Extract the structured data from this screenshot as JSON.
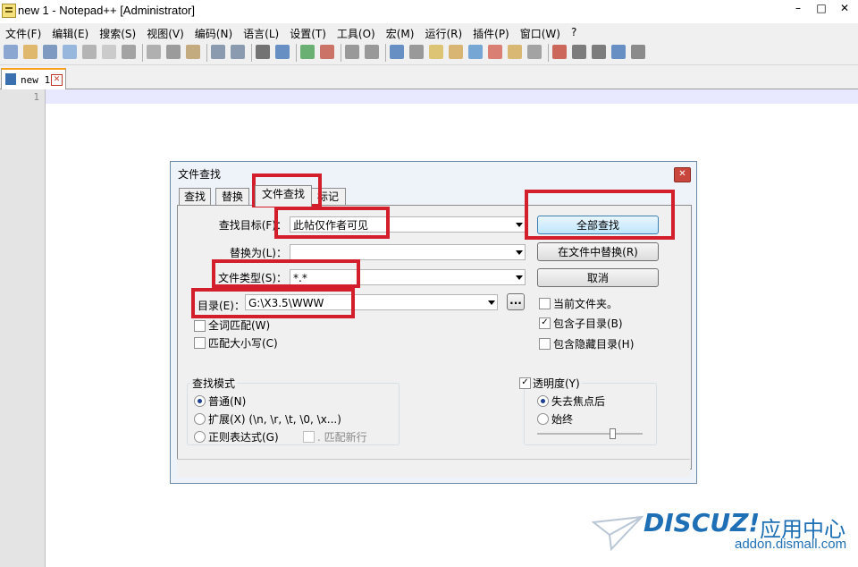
{
  "window": {
    "title": "new 1 - Notepad++ [Administrator]",
    "min": "–",
    "max": "□",
    "close": "✕"
  },
  "menu": [
    "文件(F)",
    "编辑(E)",
    "搜索(S)",
    "视图(V)",
    "编码(N)",
    "语言(L)",
    "设置(T)",
    "工具(O)",
    "宏(M)",
    "运行(R)",
    "插件(P)",
    "窗口(W)",
    "?"
  ],
  "toolbar_icons": [
    "new-file-icon",
    "open-file-icon",
    "save-icon",
    "save-all-icon",
    "close-icon",
    "close-all-icon",
    "print-icon",
    "cut-icon",
    "copy-icon",
    "paste-icon",
    "undo-icon",
    "redo-icon",
    "find-icon",
    "replace-icon",
    "zoom-in-icon",
    "zoom-out-icon",
    "sync-v-icon",
    "sync-h-icon",
    "wrap-icon",
    "show-all-icon",
    "indent-guide-icon",
    "udl-icon",
    "doc-map-icon",
    "function-list-icon",
    "folder-workspace-icon",
    "monitor-icon",
    "record-icon",
    "stop-icon",
    "play-icon",
    "play-multi-icon",
    "save-macro-icon"
  ],
  "doc_tab": {
    "label": "new 1",
    "close": "✕"
  },
  "editor": {
    "line_number": "1"
  },
  "dialog": {
    "title": "文件查找",
    "close": "✕",
    "tabs": [
      "查找",
      "替换",
      "文件查找",
      "标记"
    ],
    "active_tab": 2,
    "find_label": "查找目标(F)：",
    "find_value": "此帖仅作者可见",
    "replace_label": "替换为(L)：",
    "replace_value": "",
    "filetype_label": "文件类型(S)：",
    "filetype_value": "*.*",
    "dir_label": "目录(E)：",
    "dir_value": "G:\\X3.5\\WWW",
    "browse": "...",
    "btn_find_all": "全部查找",
    "btn_replace_in_files": "在文件中替换(R)",
    "btn_cancel": "取消",
    "whole_word": "全词匹配(W)",
    "match_case": "匹配大小写(C)",
    "current_folder": "当前文件夹。",
    "subfolders": "包含子目录(B)",
    "hidden_folders": "包含隐藏目录(H)",
    "mode_title": "查找模式",
    "mode_normal": "普通(N)",
    "mode_extended": "扩展(X) (\\n, \\r, \\t, \\0, \\x...)",
    "mode_regex": "正则表达式(G)",
    "dot_newline": ". 匹配新行",
    "transparency": "透明度(Y)",
    "on_lose_focus": "失去焦点后",
    "always": "始终",
    "subfolders_checked": true,
    "transparency_checked": true,
    "mode_selected": "normal",
    "transparency_option": "on_lose_focus"
  },
  "watermark": {
    "brand": "DISCUZ!",
    "sub": "应用中心",
    "url": "addon.dismall.com"
  },
  "colors": {
    "highlight_red": "#d21f2b",
    "watermark_blue": "#1e6fb5",
    "tab_accent": "#f9a11b"
  }
}
